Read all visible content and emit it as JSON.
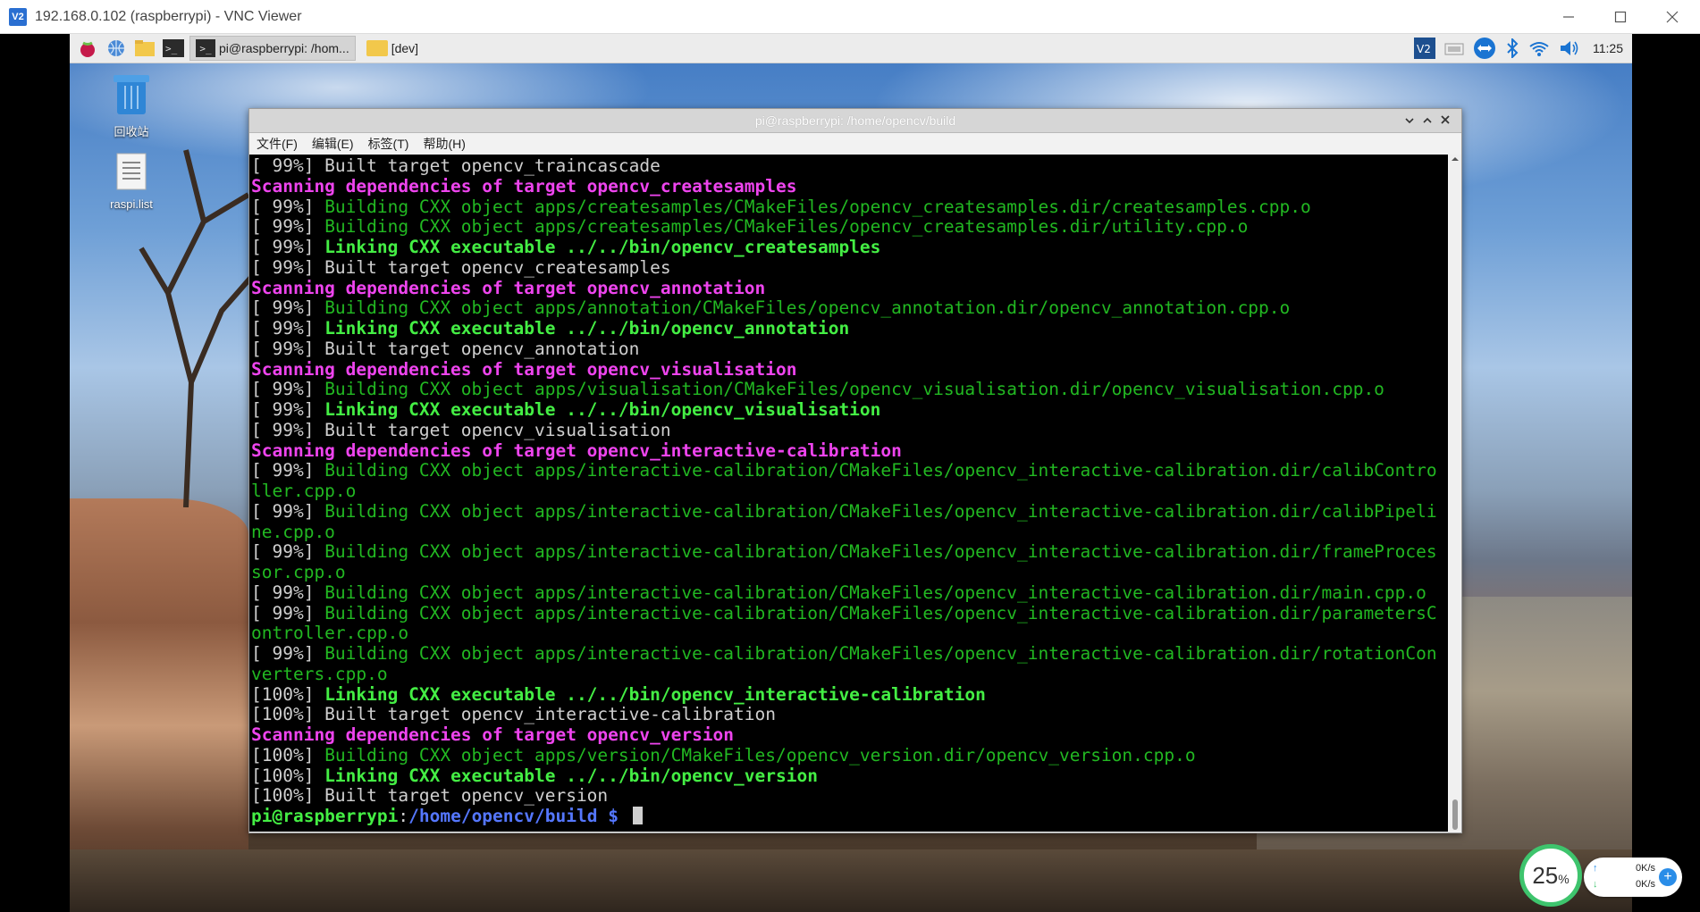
{
  "vnc": {
    "title": "192.168.0.102 (raspberrypi) - VNC Viewer",
    "logo": "V2"
  },
  "panel": {
    "tasks": [
      {
        "label": "pi@raspberrypi: /hom...",
        "icon": "terminal-icon"
      },
      {
        "label": "[dev]",
        "icon": "folder-icon"
      }
    ],
    "clock": "11:25"
  },
  "desktop": {
    "icons": [
      {
        "label": "回收站",
        "icon": "trash-icon"
      },
      {
        "label": "raspi.list",
        "icon": "text-file-icon"
      }
    ]
  },
  "terminal": {
    "title": "pi@raspberrypi: /home/opencv/build",
    "menu": [
      "文件(F)",
      "编辑(E)",
      "标签(T)",
      "帮助(H)"
    ],
    "lines": [
      [
        {
          "t": "[ 99%] Built target opencv_traincascade",
          "c": "plain"
        }
      ],
      [
        {
          "t": "Scanning dependencies of target opencv_createsamples",
          "c": "magenta"
        }
      ],
      [
        {
          "t": "[ 99%] ",
          "c": "plain"
        },
        {
          "t": "Building CXX object apps/createsamples/CMakeFiles/opencv_createsamples.dir/createsamples.cpp.o",
          "c": "green"
        }
      ],
      [
        {
          "t": "[ 99%] ",
          "c": "plain"
        },
        {
          "t": "Building CXX object apps/createsamples/CMakeFiles/opencv_createsamples.dir/utility.cpp.o",
          "c": "green"
        }
      ],
      [
        {
          "t": "[ 99%] ",
          "c": "plain"
        },
        {
          "t": "Linking CXX executable ../../bin/opencv_createsamples",
          "c": "bgreen"
        }
      ],
      [
        {
          "t": "[ 99%] Built target opencv_createsamples",
          "c": "plain"
        }
      ],
      [
        {
          "t": "Scanning dependencies of target opencv_annotation",
          "c": "magenta"
        }
      ],
      [
        {
          "t": "[ 99%] ",
          "c": "plain"
        },
        {
          "t": "Building CXX object apps/annotation/CMakeFiles/opencv_annotation.dir/opencv_annotation.cpp.o",
          "c": "green"
        }
      ],
      [
        {
          "t": "[ 99%] ",
          "c": "plain"
        },
        {
          "t": "Linking CXX executable ../../bin/opencv_annotation",
          "c": "bgreen"
        }
      ],
      [
        {
          "t": "[ 99%] Built target opencv_annotation",
          "c": "plain"
        }
      ],
      [
        {
          "t": "Scanning dependencies of target opencv_visualisation",
          "c": "magenta"
        }
      ],
      [
        {
          "t": "[ 99%] ",
          "c": "plain"
        },
        {
          "t": "Building CXX object apps/visualisation/CMakeFiles/opencv_visualisation.dir/opencv_visualisation.cpp.o",
          "c": "green"
        }
      ],
      [
        {
          "t": "[ 99%] ",
          "c": "plain"
        },
        {
          "t": "Linking CXX executable ../../bin/opencv_visualisation",
          "c": "bgreen"
        }
      ],
      [
        {
          "t": "[ 99%] Built target opencv_visualisation",
          "c": "plain"
        }
      ],
      [
        {
          "t": "Scanning dependencies of target opencv_interactive-calibration",
          "c": "magenta"
        }
      ],
      [
        {
          "t": "[ 99%] ",
          "c": "plain"
        },
        {
          "t": "Building CXX object apps/interactive-calibration/CMakeFiles/opencv_interactive-calibration.dir/calibContro",
          "c": "green"
        }
      ],
      [
        {
          "t": "ller.cpp.o",
          "c": "green"
        }
      ],
      [
        {
          "t": "[ 99%] ",
          "c": "plain"
        },
        {
          "t": "Building CXX object apps/interactive-calibration/CMakeFiles/opencv_interactive-calibration.dir/calibPipeli",
          "c": "green"
        }
      ],
      [
        {
          "t": "ne.cpp.o",
          "c": "green"
        }
      ],
      [
        {
          "t": "[ 99%] ",
          "c": "plain"
        },
        {
          "t": "Building CXX object apps/interactive-calibration/CMakeFiles/opencv_interactive-calibration.dir/frameProces",
          "c": "green"
        }
      ],
      [
        {
          "t": "sor.cpp.o",
          "c": "green"
        }
      ],
      [
        {
          "t": "[ 99%] ",
          "c": "plain"
        },
        {
          "t": "Building CXX object apps/interactive-calibration/CMakeFiles/opencv_interactive-calibration.dir/main.cpp.o",
          "c": "green"
        }
      ],
      [
        {
          "t": "[ 99%] ",
          "c": "plain"
        },
        {
          "t": "Building CXX object apps/interactive-calibration/CMakeFiles/opencv_interactive-calibration.dir/parametersC",
          "c": "green"
        }
      ],
      [
        {
          "t": "ontroller.cpp.o",
          "c": "green"
        }
      ],
      [
        {
          "t": "[ 99%] ",
          "c": "plain"
        },
        {
          "t": "Building CXX object apps/interactive-calibration/CMakeFiles/opencv_interactive-calibration.dir/rotationCon",
          "c": "green"
        }
      ],
      [
        {
          "t": "verters.cpp.o",
          "c": "green"
        }
      ],
      [
        {
          "t": "[100%] ",
          "c": "plain"
        },
        {
          "t": "Linking CXX executable ../../bin/opencv_interactive-calibration",
          "c": "bgreen"
        }
      ],
      [
        {
          "t": "[100%] Built target opencv_interactive-calibration",
          "c": "plain"
        }
      ],
      [
        {
          "t": "Scanning dependencies of target opencv_version",
          "c": "magenta"
        }
      ],
      [
        {
          "t": "[100%] ",
          "c": "plain"
        },
        {
          "t": "Building CXX object apps/version/CMakeFiles/opencv_version.dir/opencv_version.cpp.o",
          "c": "green"
        }
      ],
      [
        {
          "t": "[100%] ",
          "c": "plain"
        },
        {
          "t": "Linking CXX executable ../../bin/opencv_version",
          "c": "bgreen"
        }
      ],
      [
        {
          "t": "[100%] Built target opencv_version",
          "c": "plain"
        }
      ]
    ],
    "prompt": {
      "user": "pi@raspberrypi",
      "sep": ":",
      "path": "/home/opencv/build",
      "symbol": " $ "
    }
  },
  "network": {
    "percent": "25",
    "percent_unit": "%",
    "upload": "0K/s",
    "download": "0K/s"
  },
  "colors": {
    "magenta": "#ee44ee",
    "green": "#22b822",
    "bright_green": "#44ee44",
    "blue": "#5577ff",
    "ring": "#3ec46d"
  }
}
